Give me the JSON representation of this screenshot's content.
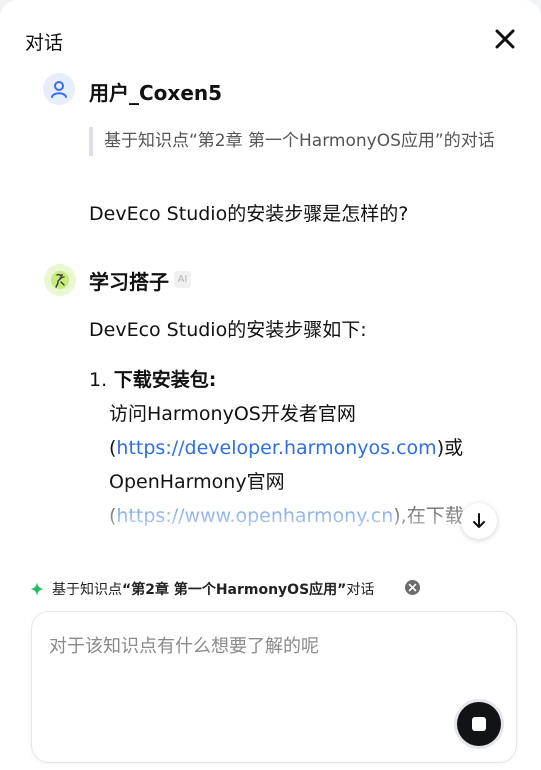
{
  "header": {
    "title": "对话",
    "close_icon": "close-icon"
  },
  "user_message": {
    "avatar_icon": "user-icon",
    "name": "用户_Coxen5",
    "quote": "基于知识点“第2章 第一个HarmonyOS应用”的对话",
    "question": "DevEco Studio的安装步骤是怎样的?"
  },
  "ai_message": {
    "avatar_icon": "study-buddy-avatar-icon",
    "name": "学习搭子",
    "badge": "AI",
    "intro": "DevEco Studio的安装步骤如下:",
    "steps": [
      {
        "number": "1.",
        "title": "下载安装包:",
        "content_prefix": "访问HarmonyOS开发者官网(",
        "link1": "https://developer.harmonyos.com",
        "content_middle": ")或OpenHarmony官网(",
        "link2": "https://www.openharmony.cn",
        "content_suffix": "),在下载"
      }
    ]
  },
  "scroll_down": {
    "icon": "arrow-down-icon"
  },
  "context_bar": {
    "icon": "sparkle-icon",
    "prefix": "基于知识点",
    "topic": "“第2章 第一个HarmonyOS应用”",
    "suffix": "对话",
    "clear_icon": "clear-icon"
  },
  "composer": {
    "placeholder": "对于该知识点有什么想要了解的呢",
    "value": "",
    "stop_icon": "stop-icon"
  },
  "colors": {
    "accent_green": "#1fbf5f",
    "link_blue": "#2f6fdf",
    "user_avatar_bg": "#e6eefc",
    "ai_avatar_bg": "#eaf7d3"
  }
}
